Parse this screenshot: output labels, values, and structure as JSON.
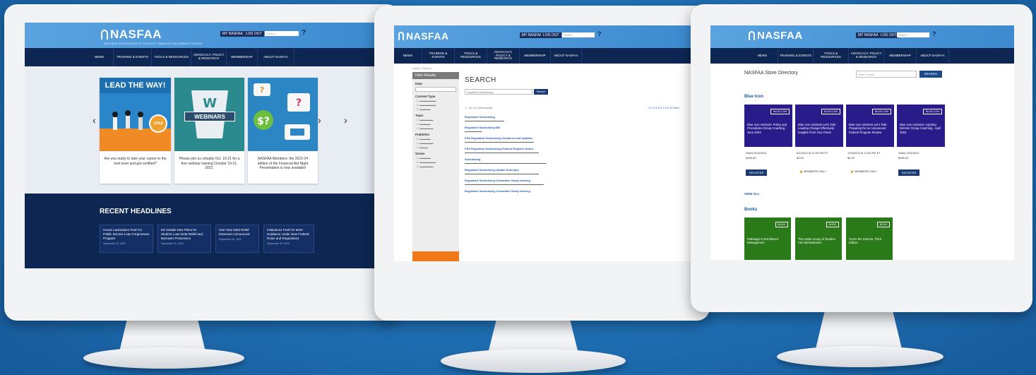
{
  "brand": {
    "logo": "NASFAA",
    "tagline": "NATIONAL ASSOCIATION OF STUDENT FINANCIAL AID ADMINISTRATORS"
  },
  "header": {
    "my_nasfaa": "MY NASFAA",
    "log_out": "LOG OUT",
    "search_placeholder": "Search",
    "help_icon": "?"
  },
  "nav": {
    "items": [
      "NEWS",
      "TRAINING & EVENTS",
      "TOOLS & RESOURCES",
      "ADVOCACY, POLICY & RESEARCH",
      "MEMBERSHIP",
      "ABOUT NASFAA"
    ]
  },
  "home": {
    "cards": [
      {
        "title": "LEAD THE WAY!",
        "badge": "CFAA",
        "text": "Are you ready to take your career to the next level and get certified?"
      },
      {
        "title": "WEBINARS",
        "text": "Please join us virtually Oct. 19-21 for a free webinar training October 19-21, 2022."
      },
      {
        "text": "NASFAA Members: the 2023-24 edition of the Financial Aid Night Presentation is now available!"
      }
    ],
    "headlines_title": "RECENT HEADLINES",
    "headlines": [
      {
        "title": "House Lawmakers Push for Public Service Loan Forgiveness Program",
        "date": "September 22, 2022"
      },
      {
        "title": "ED Details New Plans for Student Loan Debt Relief and Borrower Protections",
        "date": "September 21, 2022"
      },
      {
        "title": "One-Year Debt Relief Extension Announced",
        "date": "September 20, 2022"
      },
      {
        "title": "Institutions Push for More Guidance Under New Federal Rules and Regulations",
        "date": "September 19, 2022"
      }
    ]
  },
  "search_page": {
    "breadcrumb": "Home / Search",
    "filter_title": "Filter Results",
    "filter_labels": [
      "Date",
      "Content Type",
      "Topic",
      "Publisher",
      "Series"
    ],
    "title": "SEARCH",
    "query": "regulated subsidizing",
    "search_button": "Search",
    "results_summary": "1 - 10 of 1,028 results",
    "pager": "1 2 3 4 5 6 7 8 9 10 Next",
    "results": [
      "Regulated Subsidizing",
      "Regulated Subsidizing Bill",
      "FSA Regulated Subsidizing Guidance and Updates",
      "FSA Regulated Subsidizing Federal Register Notice",
      "Subsidizing",
      "Regulated Subsidizing Update Summary",
      "Regulated Subsidizing Committee Study Hearing",
      "Regulated Subsidizing Committee Study Hearing"
    ]
  },
  "store": {
    "title": "NASFAA Store Directory",
    "search_placeholder": "Store Search",
    "search_button": "SEARCH",
    "blue_icon_heading": "Blue Icon",
    "view_all": "VIEW ALL",
    "blue_items": [
      {
        "badge": "BLUE ICON",
        "name": "Blue Icon Advisors: Policy and Procedures Group Coaching - June 2023",
        "date": "Starts 6/15/2023",
        "price": "$395.00",
        "action": "REGISTER"
      },
      {
        "badge": "BLUE ICON",
        "name": "Blue Icon Advisors Let's Talk - Leading Change Effectively: Insights From Your Peers",
        "date": "6/1/2023 at 12:00 PM ET",
        "price": "$0.00",
        "action": "MEMBERS ONLY"
      },
      {
        "badge": "BLUE ICON",
        "name": "Blue Icon Advisors Let's Talk - Preparing for an Announced Federal Program Review",
        "date": "7/20/2023 at 12:00 PM ET",
        "price": "$0.00",
        "action": "MEMBERS ONLY"
      },
      {
        "badge": "BLUE ICON",
        "name": "Blue Icon Advisors: Aspiring Director Group Coaching - April 2023",
        "date": "Starts 4/20/2023",
        "price": "$395.00",
        "action": "REGISTER"
      }
    ],
    "books_heading": "Books",
    "book_items": [
      {
        "badge": "BOOK",
        "name": "Pathways to Enrollment Management"
      },
      {
        "badge": "BOOK",
        "name": "The Inside Scoop of Student Aid Administration"
      },
      {
        "badge": "BOOK",
        "name": "You're the Director, Third Edition"
      }
    ]
  },
  "colors": {
    "background": "#2177bd",
    "nav": "#0d2652",
    "header": "#4a97d9",
    "blue_product": "#2a1b8a",
    "book_product": "#2a7a1a",
    "accent_orange": "#f07a1a"
  }
}
